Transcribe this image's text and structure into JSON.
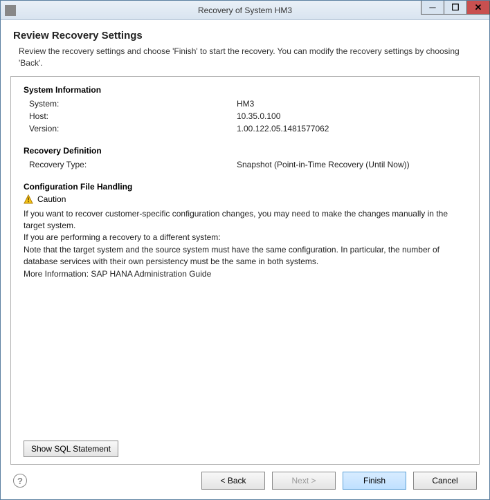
{
  "titlebar": {
    "title": "Recovery of System HM3"
  },
  "header": {
    "title": "Review Recovery Settings",
    "description": "Review the recovery settings and choose 'Finish' to start the recovery. You can modify the recovery settings by choosing 'Back'."
  },
  "system_info": {
    "heading": "System Information",
    "system_label": "System:",
    "system_value": "HM3",
    "host_label": "Host:",
    "host_value": "10.35.0.100",
    "version_label": "Version:",
    "version_value": "1.00.122.05.1481577062"
  },
  "recovery_def": {
    "heading": "Recovery Definition",
    "type_label": "Recovery Type:",
    "type_value": "Snapshot (Point-in-Time Recovery (Until Now))"
  },
  "config": {
    "heading": "Configuration File Handling",
    "caution_label": "Caution",
    "line1": "If you want to recover customer-specific configuration changes, you may need to make the changes manually in the target system.",
    "line2": "If you are performing a recovery to a different system:",
    "line3": "Note that the target system and the source system must have the same configuration. In particular, the number of database services with their own persistency must be the same in both systems.",
    "line4": "More Information: SAP HANA Administration Guide"
  },
  "buttons": {
    "show_sql": "Show SQL Statement",
    "back": "< Back",
    "next": "Next >",
    "finish": "Finish",
    "cancel": "Cancel"
  }
}
